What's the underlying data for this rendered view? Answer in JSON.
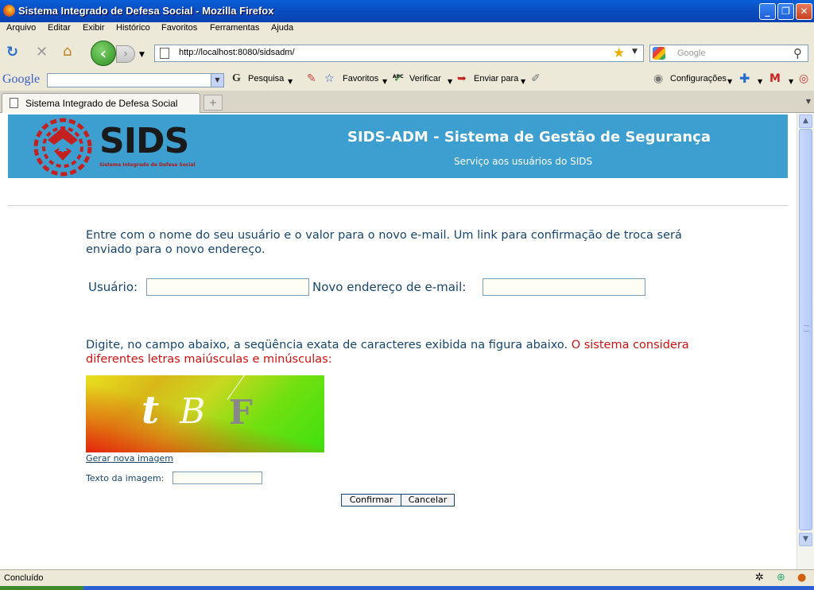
{
  "window": {
    "title": "Sistema Integrado de Defesa Social - Mozilla Firefox"
  },
  "menu": {
    "items": [
      "Arquivo",
      "Editar",
      "Exibir",
      "Histórico",
      "Favoritos",
      "Ferramentas",
      "Ajuda"
    ]
  },
  "nav": {
    "url": "http://localhost:8080/sidsadm/",
    "search_placeholder": "Google"
  },
  "google_toolbar": {
    "logo": "Google",
    "pesquisa": "Pesquisa",
    "favoritos": "Favoritos",
    "verificar": "Verificar",
    "verificar_badge": "ABC",
    "enviar": "Enviar para",
    "configuracoes": "Configurações"
  },
  "tab": {
    "label": "Sistema Integrado de Defesa Social"
  },
  "banner": {
    "logo_text": "SIDS",
    "logo_subtitle": "Sistema Integrado de Defesa Social",
    "title": "SIDS-ADM - Sistema de Gestão de Segurança",
    "subtitle": "Serviço aos usuários do SIDS"
  },
  "form": {
    "intro": "Entre com o nome do seu usuário e o valor para o novo e-mail. Um link para confirmação de troca será enviado para o novo endereço.",
    "usuario_label": "Usuário:",
    "usuario_value": "",
    "email_label": "Novo endereço de e-mail:",
    "email_value": "",
    "captcha_instruction": "Digite, no campo abaixo, a seqüência exata de caracteres exibida na figura abaixo.",
    "captcha_warning": "O sistema considera diferentes letras maiúsculas e minúsculas:",
    "captcha_chars": [
      "t",
      "B",
      "F"
    ],
    "gerar_link": "Gerar nova imagem",
    "texto_label": "Texto da imagem:",
    "texto_value": "",
    "confirm_button": "Confirmar",
    "cancel_button": "Cancelar"
  },
  "status": {
    "text": "Concluído"
  },
  "colors": {
    "banner": "#3d9ed0",
    "text": "#17456e",
    "warning": "#cc1111"
  }
}
